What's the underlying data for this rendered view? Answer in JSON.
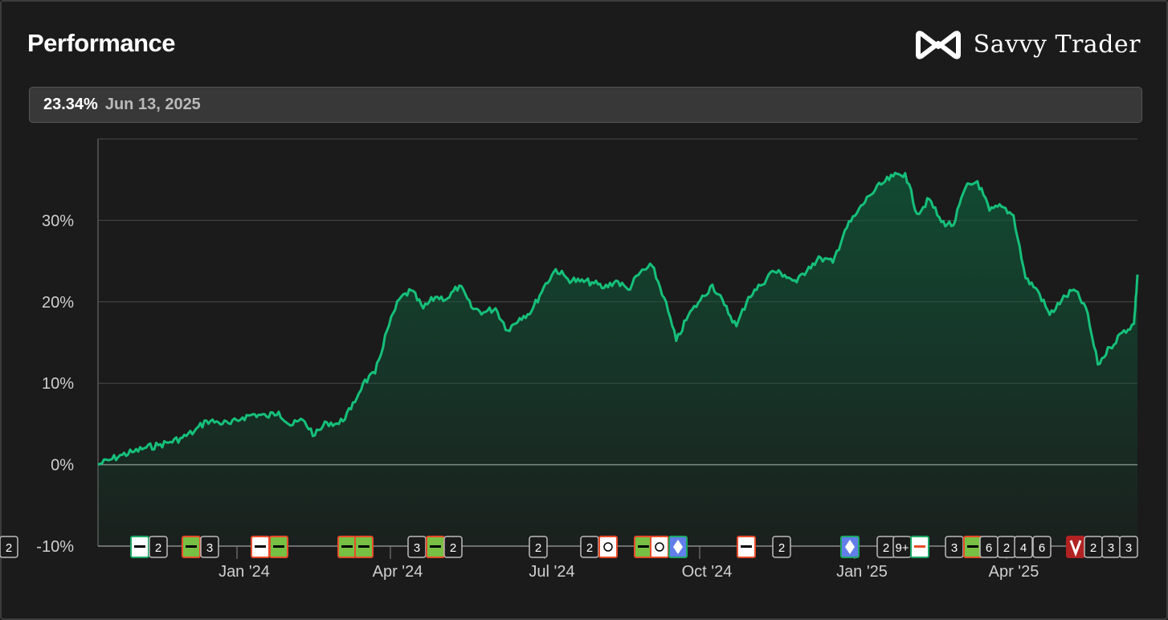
{
  "header": {
    "title": "Performance",
    "brand_name": "Savvy Trader"
  },
  "readout": {
    "value": "23.34%",
    "date": "Jun 13, 2025"
  },
  "colors": {
    "line": "#16c07a",
    "fill": "#0f5a3a",
    "background": "#1b1b1b",
    "grid": "#4a4a4a"
  },
  "chart_data": {
    "type": "area",
    "x_labels": [
      "Jan '24",
      "Apr '24",
      "Jul '24",
      "Oct '24",
      "Jan '25",
      "Apr '25"
    ],
    "y_tick_labels": [
      "-10%",
      "0%",
      "10%",
      "20%",
      "30%"
    ],
    "y_ticks": [
      -10,
      0,
      10,
      20,
      30
    ],
    "ylim": [
      -10,
      40
    ],
    "xlim": [
      "2023-10-18",
      "2025-06-13"
    ],
    "grid": true,
    "series": [
      {
        "values": [
          [
            "2023-10-18",
            0.0
          ],
          [
            "2023-10-25",
            0.6
          ],
          [
            "2023-11-01",
            1.2
          ],
          [
            "2023-11-08",
            1.6
          ],
          [
            "2023-11-15",
            2.1
          ],
          [
            "2023-11-22",
            2.4
          ],
          [
            "2023-11-29",
            2.8
          ],
          [
            "2023-12-06",
            3.3
          ],
          [
            "2023-12-13",
            4.1
          ],
          [
            "2023-12-20",
            5.4
          ],
          [
            "2023-12-27",
            5.2
          ],
          [
            "2024-01-03",
            5.0
          ],
          [
            "2024-01-10",
            5.8
          ],
          [
            "2024-01-17",
            6.2
          ],
          [
            "2024-01-24",
            5.9
          ],
          [
            "2024-01-31",
            6.5
          ],
          [
            "2024-02-07",
            4.8
          ],
          [
            "2024-02-14",
            5.5
          ],
          [
            "2024-02-21",
            3.6
          ],
          [
            "2024-02-28",
            5.2
          ],
          [
            "2024-03-06",
            5.0
          ],
          [
            "2024-03-13",
            6.8
          ],
          [
            "2024-03-20",
            10.0
          ],
          [
            "2024-03-27",
            11.2
          ],
          [
            "2024-04-03",
            16.5
          ],
          [
            "2024-04-10",
            20.3
          ],
          [
            "2024-04-17",
            21.4
          ],
          [
            "2024-04-24",
            19.2
          ],
          [
            "2024-05-01",
            20.6
          ],
          [
            "2024-05-08",
            20.4
          ],
          [
            "2024-05-15",
            22.0
          ],
          [
            "2024-05-22",
            19.3
          ],
          [
            "2024-05-29",
            18.7
          ],
          [
            "2024-06-05",
            19.2
          ],
          [
            "2024-06-12",
            16.5
          ],
          [
            "2024-06-19",
            18.0
          ],
          [
            "2024-06-26",
            18.9
          ],
          [
            "2024-07-03",
            21.8
          ],
          [
            "2024-07-10",
            24.0
          ],
          [
            "2024-07-17",
            22.8
          ],
          [
            "2024-07-24",
            22.5
          ],
          [
            "2024-07-31",
            22.4
          ],
          [
            "2024-08-07",
            21.7
          ],
          [
            "2024-08-14",
            22.6
          ],
          [
            "2024-08-21",
            21.5
          ],
          [
            "2024-08-28",
            23.6
          ],
          [
            "2024-09-04",
            24.4
          ],
          [
            "2024-09-11",
            20.5
          ],
          [
            "2024-09-18",
            15.2
          ],
          [
            "2024-09-25",
            18.3
          ],
          [
            "2024-10-02",
            20.2
          ],
          [
            "2024-10-09",
            22.1
          ],
          [
            "2024-10-16",
            19.6
          ],
          [
            "2024-10-23",
            17.0
          ],
          [
            "2024-10-30",
            20.6
          ],
          [
            "2024-11-06",
            22.0
          ],
          [
            "2024-11-13",
            23.8
          ],
          [
            "2024-11-20",
            23.3
          ],
          [
            "2024-11-27",
            22.4
          ],
          [
            "2024-12-04",
            24.3
          ],
          [
            "2024-12-11",
            25.4
          ],
          [
            "2024-12-18",
            24.8
          ],
          [
            "2024-12-25",
            28.8
          ],
          [
            "2025-01-01",
            30.9
          ],
          [
            "2025-01-08",
            33.0
          ],
          [
            "2025-01-15",
            34.4
          ],
          [
            "2025-01-22",
            35.4
          ],
          [
            "2025-01-29",
            35.8
          ],
          [
            "2025-02-05",
            30.8
          ],
          [
            "2025-02-12",
            32.6
          ],
          [
            "2025-02-19",
            29.8
          ],
          [
            "2025-02-26",
            29.4
          ],
          [
            "2025-03-05",
            34.0
          ],
          [
            "2025-03-12",
            34.8
          ],
          [
            "2025-03-19",
            31.2
          ],
          [
            "2025-03-26",
            31.7
          ],
          [
            "2025-04-02",
            30.6
          ],
          [
            "2025-04-09",
            22.9
          ],
          [
            "2025-04-16",
            21.4
          ],
          [
            "2025-04-23",
            18.4
          ],
          [
            "2025-04-30",
            20.2
          ],
          [
            "2025-05-07",
            21.5
          ],
          [
            "2025-05-14",
            19.3
          ],
          [
            "2025-05-21",
            12.3
          ],
          [
            "2025-05-28",
            14.4
          ],
          [
            "2025-06-04",
            16.2
          ],
          [
            "2025-06-11",
            17.3
          ],
          [
            "2025-06-13",
            23.34
          ]
        ]
      }
    ]
  },
  "event_markers": [
    {
      "icon": "sentinel-logo",
      "count": "2"
    },
    {
      "icon": "ishares-logo",
      "count": "3"
    },
    {
      "icon": "uscf-logo",
      "count": ""
    },
    {
      "icon": "ishares-logo",
      "count": ""
    },
    {
      "icon": "ishares-logo",
      "count": ""
    },
    {
      "icon": "ishares-logo",
      "count": "3"
    },
    {
      "icon": "ishares-logo",
      "count": "2"
    },
    {
      "icon": "",
      "count": "2"
    },
    {
      "icon": "",
      "count": "2"
    },
    {
      "icon": "circle-logo",
      "count": ""
    },
    {
      "icon": "ishares-logo",
      "count": ""
    },
    {
      "icon": "circle-logo",
      "count": ""
    },
    {
      "icon": "ethereum-logo",
      "count": ""
    },
    {
      "icon": "uscf-logo",
      "count": ""
    },
    {
      "icon": "",
      "count": "2"
    },
    {
      "icon": "ethereum-logo",
      "count": ""
    },
    {
      "icon": "",
      "count": "2"
    },
    {
      "icon": "",
      "count": "9+"
    },
    {
      "icon": "global-logo",
      "count": "3"
    },
    {
      "icon": "ishares-logo",
      "count": "6"
    },
    {
      "icon": "",
      "count": "2"
    },
    {
      "icon": "",
      "count": "4"
    },
    {
      "icon": "",
      "count": "6"
    },
    {
      "icon": "v-logo",
      "count": ""
    },
    {
      "icon": "",
      "count": "2"
    },
    {
      "icon": "",
      "count": "3"
    },
    {
      "icon": "",
      "count": "3"
    },
    {
      "icon": "",
      "count": "2"
    }
  ]
}
